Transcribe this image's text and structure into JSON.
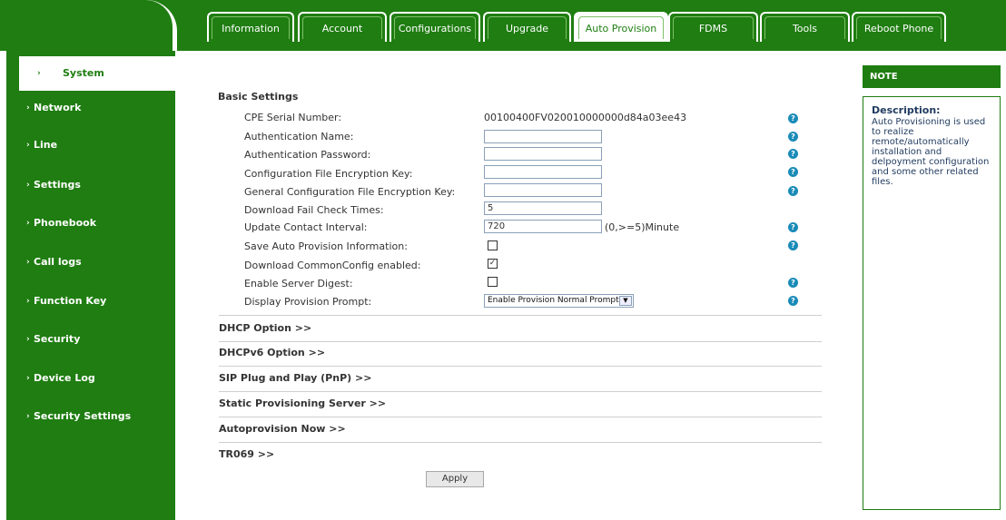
{
  "tabs": [
    "Information",
    "Account",
    "Configurations",
    "Upgrade",
    "Auto Provision",
    "FDMS",
    "Tools",
    "Reboot Phone"
  ],
  "active_tab": "Auto Provision",
  "sidebar": {
    "items": [
      {
        "label": "System"
      },
      {
        "label": "Network"
      },
      {
        "label": "Line"
      },
      {
        "label": "Settings"
      },
      {
        "label": "Phonebook"
      },
      {
        "label": "Call logs"
      },
      {
        "label": "Function Key"
      },
      {
        "label": "Security"
      },
      {
        "label": "Device Log"
      },
      {
        "label": "Security Settings"
      }
    ],
    "active": "System"
  },
  "basic": {
    "title": "Basic Settings",
    "cpe_label": "CPE Serial Number:",
    "cpe_value": "00100400FV020010000000d84a03ee43",
    "auth_name_label": "Authentication Name:",
    "auth_name_value": "",
    "auth_pwd_label": "Authentication Password:",
    "auth_pwd_value": "",
    "cfg_key_label": "Configuration File Encryption Key:",
    "cfg_key_value": "",
    "gen_key_label": "General Configuration File Encryption Key:",
    "gen_key_value": "",
    "fail_label": "Download Fail Check Times:",
    "fail_value": "5",
    "contact_label": "Update Contact Interval:",
    "contact_value": "720",
    "contact_hint": "(0,>=5)Minute",
    "save_label": "Save Auto Provision Information:",
    "save_checked": false,
    "common_label": "Download CommonConfig enabled:",
    "common_checked": true,
    "digest_label": "Enable Server Digest:",
    "digest_checked": false,
    "prompt_label": "Display Provision Prompt:",
    "prompt_value": "Enable Provision Normal Prompt"
  },
  "sections": [
    "DHCP Option >>",
    "DHCPv6 Option >>",
    "SIP Plug and Play (PnP) >>",
    "Static Provisioning Server >>",
    "Autoprovision Now >>",
    "TR069 >>"
  ],
  "apply_label": "Apply",
  "note": {
    "header": "NOTE",
    "title": "Description:",
    "text": "Auto Provisioning is used to realize remote/automatically installation and delpoyment configuration and some other related files."
  },
  "colors": {
    "brand": "#1f7d11",
    "help": "#1a8bb8"
  }
}
